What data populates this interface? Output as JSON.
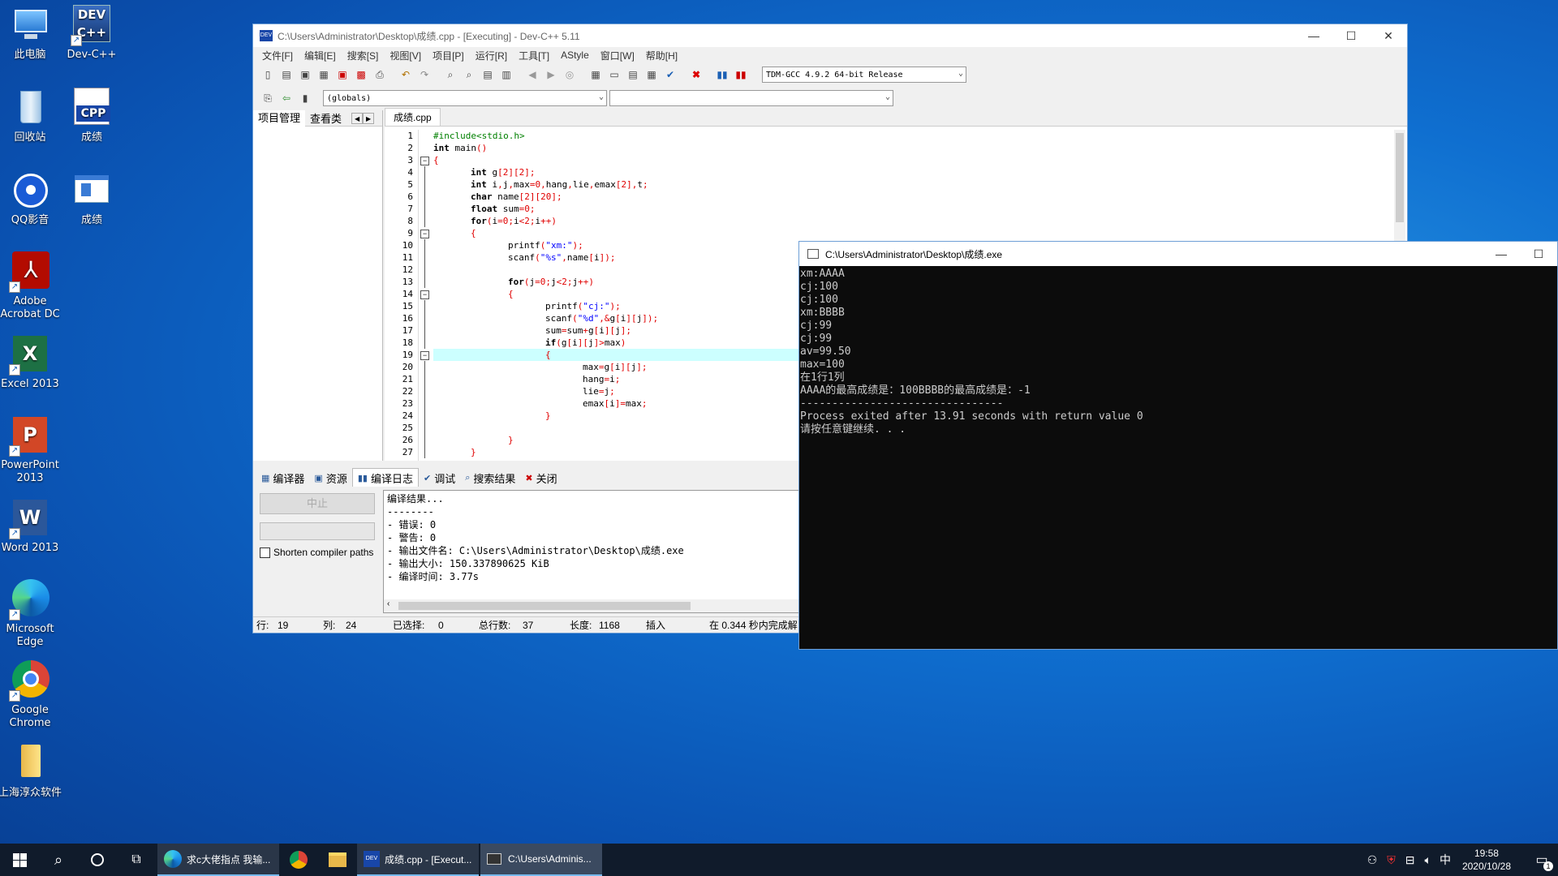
{
  "desktop": {
    "icons": [
      {
        "label": "此电脑"
      },
      {
        "label": "Dev-C++"
      },
      {
        "label": "回收站"
      },
      {
        "label": "成绩"
      },
      {
        "label": "QQ影音"
      },
      {
        "label": "成绩"
      },
      {
        "label": "Adobe Acrobat DC"
      },
      {
        "label": "Excel 2013"
      },
      {
        "label": "PowerPoint 2013"
      },
      {
        "label": "Word 2013"
      },
      {
        "label": "Microsoft Edge"
      },
      {
        "label": "Google Chrome"
      },
      {
        "label": "上海淳众软件"
      }
    ]
  },
  "devcpp": {
    "title": "C:\\Users\\Administrator\\Desktop\\成绩.cpp - [Executing] - Dev-C++ 5.11",
    "menu": [
      "文件[F]",
      "编辑[E]",
      "搜索[S]",
      "视图[V]",
      "项目[P]",
      "运行[R]",
      "工具[T]",
      "AStyle",
      "窗口[W]",
      "帮助[H]"
    ],
    "compiler_select": "TDM-GCC 4.9.2 64-bit Release",
    "globals_select": "(globals)",
    "left_tabs": [
      "项目管理",
      "查看类"
    ],
    "file_tab": "成绩.cpp",
    "code_lines": [
      "#include<stdio.h>",
      "int main()",
      "{",
      "    int g[2][2];",
      "    int i,j,max=0,hang,lie,emax[2],t;",
      "    char name[2][20];",
      "    float sum=0;",
      "    for(i=0;i<2;i++)",
      "    {",
      "        printf(\"xm:\");",
      "        scanf(\"%s\",name[i]);",
      "",
      "        for(j=0;j<2;j++)",
      "        {",
      "            printf(\"cj:\");",
      "            scanf(\"%d\",&g[i][j]);",
      "            sum=sum+g[i][j];",
      "            if(g[i][j]>max)",
      "            {",
      "                max=g[i][j];",
      "                hang=i;",
      "                lie=j;",
      "                emax[i]=max;",
      "            }",
      "",
      "        }",
      "    }"
    ],
    "highlight_line": 19,
    "bottom_tabs": [
      "编译器",
      "资源",
      "编译日志",
      "调试",
      "搜索结果",
      "关闭"
    ],
    "abort_button": "中止",
    "shorten_paths": "Shorten compiler paths",
    "log_lines": [
      "编译结果...",
      "--------",
      "- 错误: 0",
      "- 警告: 0",
      "- 输出文件名: C:\\Users\\Administrator\\Desktop\\成绩.exe",
      "- 输出大小: 150.337890625 KiB",
      "- 编译时间: 3.77s"
    ],
    "status": {
      "row_label": "行:",
      "row": "19",
      "col_label": "列:",
      "col": "24",
      "sel_label": "已选择:",
      "sel": "0",
      "lines_label": "总行数:",
      "lines": "37",
      "len_label": "长度:",
      "len": "1168",
      "mode": "插入",
      "parse": "在 0.344 秒内完成解"
    }
  },
  "console": {
    "title": "C:\\Users\\Administrator\\Desktop\\成绩.exe",
    "output": [
      "xm:AAAA",
      "cj:100",
      "cj:100",
      "xm:BBBB",
      "cj:99",
      "cj:99",
      "av=99.50",
      "max=100",
      "在1行1列",
      "AAAA的最高成绩是：100BBBB的最高成绩是：-1",
      "--------------------------------",
      "Process exited after 13.91 seconds with return value 0",
      "请按任意键继续. . ."
    ]
  },
  "taskbar": {
    "edge_task": "求c大佬指点 我输...",
    "devcpp_task": "成绩.cpp - [Execut...",
    "console_task": "C:\\Users\\Adminis...",
    "ime": "中",
    "time": "19:58",
    "date": "2020/10/28",
    "notif_count": "1"
  }
}
